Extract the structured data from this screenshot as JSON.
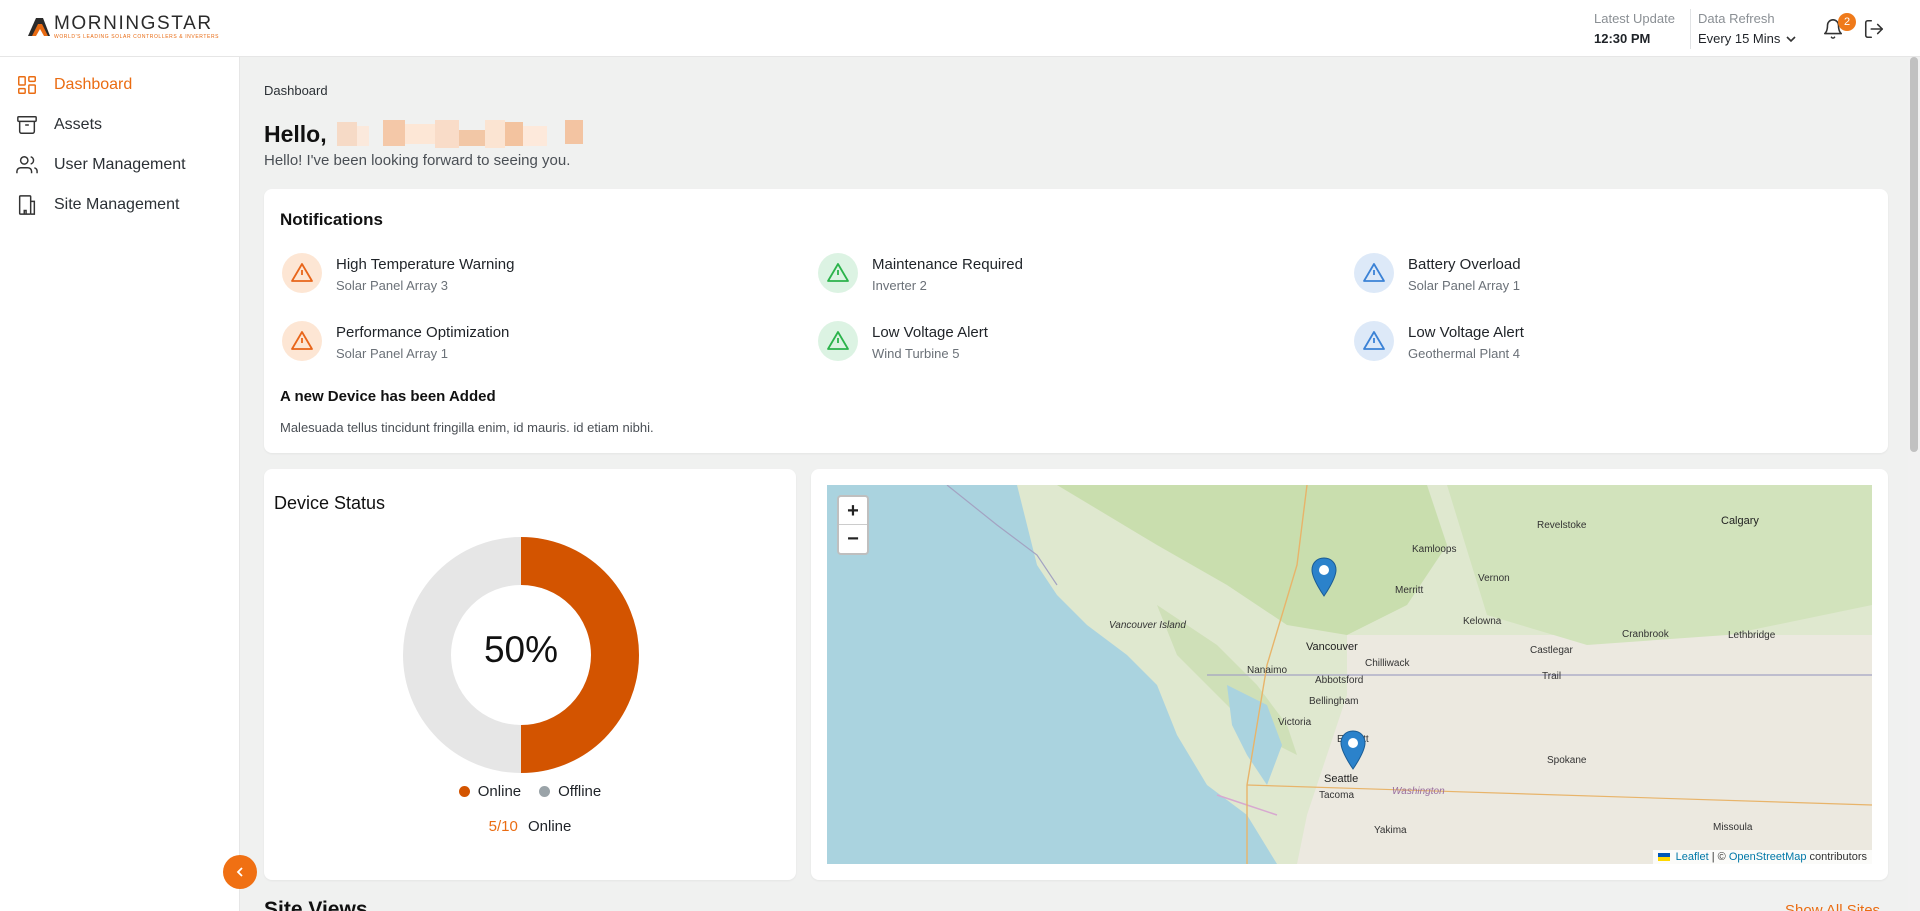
{
  "brand": {
    "name": "MORNINGSTAR",
    "tagline": "WORLD'S LEADING SOLAR CONTROLLERS & INVERTERS"
  },
  "header": {
    "latest_update_label": "Latest Update",
    "latest_update_value": "12:30 PM",
    "data_refresh_label": "Data Refresh",
    "data_refresh_value": "Every 15 Mins",
    "notification_count": "2"
  },
  "sidebar": {
    "items": [
      {
        "label": "Dashboard",
        "icon": "dashboard-icon",
        "active": true
      },
      {
        "label": "Assets",
        "icon": "archive-icon",
        "active": false
      },
      {
        "label": "User Management",
        "icon": "users-icon",
        "active": false
      },
      {
        "label": "Site Management",
        "icon": "building-icon",
        "active": false
      }
    ]
  },
  "breadcrumb": "Dashboard",
  "greeting": {
    "hello": "Hello,",
    "message": "Hello! I've been looking forward to seeing you."
  },
  "notifications": {
    "title": "Notifications",
    "items": [
      {
        "title": "High Temperature Warning",
        "source": "Solar Panel Array 3",
        "color": "orange"
      },
      {
        "title": "Maintenance Required",
        "source": "Inverter 2",
        "color": "green"
      },
      {
        "title": "Battery Overload",
        "source": "Solar Panel Array 1",
        "color": "blue"
      },
      {
        "title": "Performance Optimization",
        "source": "Solar Panel Array 1",
        "color": "orange"
      },
      {
        "title": "Low Voltage Alert",
        "source": "Wind Turbine 5",
        "color": "green"
      },
      {
        "title": "Low Voltage Alert",
        "source": "Geothermal Plant 4",
        "color": "blue"
      }
    ],
    "added_title": "A new Device has been Added",
    "added_body": "Malesuada tellus tincidunt fringilla enim, id mauris. id etiam nibhi."
  },
  "device_status": {
    "title": "Device Status",
    "percent_label": "50%",
    "online_fraction": 0.5,
    "legend_online": "Online",
    "legend_offline": "Offline",
    "count": "5/10",
    "count_suffix": "Online",
    "colors": {
      "online": "#d35400",
      "offline": "#e6e6e6"
    }
  },
  "map": {
    "zoom_in": "+",
    "zoom_out": "−",
    "attribution_leaflet": "Leaflet",
    "attribution_sep": " | © ",
    "attribution_osm": "OpenStreetMap",
    "attribution_suffix": " contributors",
    "places": [
      "Revelstoke",
      "Calgary",
      "Kamloops",
      "Vernon",
      "Merritt",
      "Kelowna",
      "Vancouver Island",
      "Vancouver",
      "Nanaimo",
      "Chilliwack",
      "Abbotsford",
      "Castlegar",
      "Cranbrook",
      "Lethbridge",
      "Trail",
      "Bellingham",
      "Victoria",
      "Everett",
      "Seattle",
      "Tacoma",
      "Washington",
      "Spokane",
      "Yakima",
      "Missoula"
    ]
  },
  "next_section": {
    "title": "Site Views",
    "link": "Show All Sites"
  }
}
